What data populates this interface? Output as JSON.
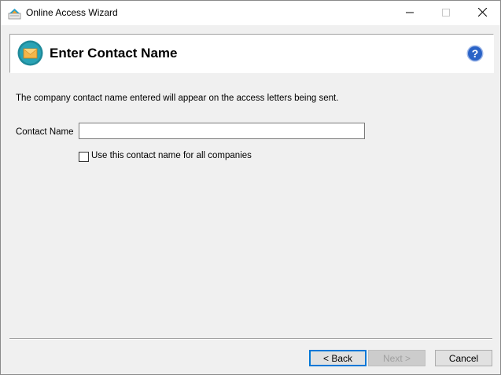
{
  "window": {
    "title": "Online Access Wizard",
    "minimize_icon": "minimize-icon",
    "maximize_icon": "maximize-icon",
    "close_icon": "close-icon"
  },
  "header": {
    "title": "Enter Contact Name",
    "icon": "envelope-icon",
    "help_icon": "help-icon"
  },
  "body": {
    "description": "The company contact name entered will appear on the access letters being sent.",
    "contact_label": "Contact Name",
    "contact_value": "",
    "checkbox_label": "Use this contact name for all companies",
    "checkbox_checked": false
  },
  "buttons": {
    "back": "< Back",
    "next": "Next >",
    "cancel": "Cancel"
  },
  "colors": {
    "accent": "#0078d7",
    "header_icon_teal": "#1f8a9a",
    "envelope_orange": "#f0a030",
    "help_blue": "#2a63c7"
  }
}
